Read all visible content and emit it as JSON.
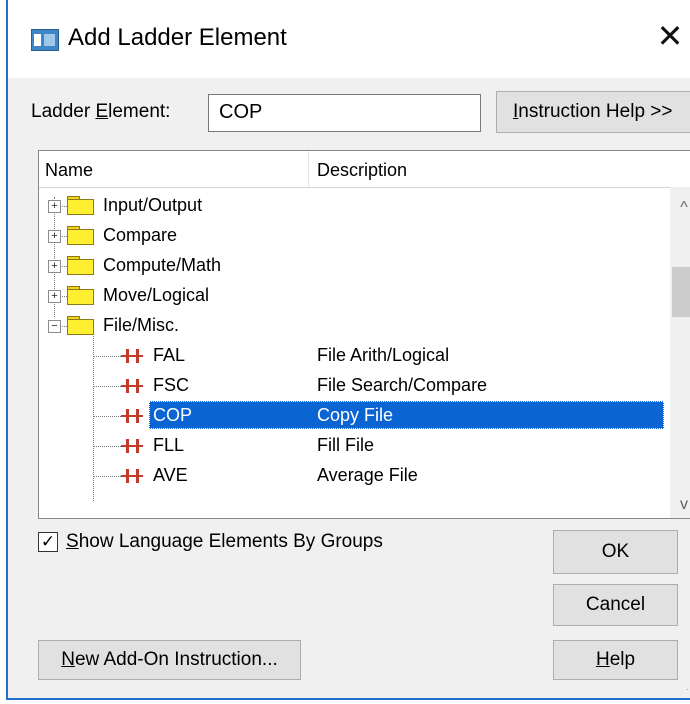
{
  "dialog": {
    "title": "Add Ladder Element",
    "close_glyph": "✕",
    "title_icon": "window-app-icon"
  },
  "element_field": {
    "label_pre": "Ladder ",
    "label_mnemonic": "E",
    "label_post": "lement:",
    "value": "COP"
  },
  "help_button": {
    "mnemonic": "I",
    "label_rest": "nstruction Help >>"
  },
  "list": {
    "columns": [
      "Name",
      "Description"
    ],
    "rows": [
      {
        "type": "group",
        "expander": "+",
        "name": "Input/Output",
        "description": ""
      },
      {
        "type": "group",
        "expander": "+",
        "name": "Compare",
        "description": ""
      },
      {
        "type": "group",
        "expander": "+",
        "name": "Compute/Math",
        "description": ""
      },
      {
        "type": "group",
        "expander": "+",
        "name": "Move/Logical",
        "description": ""
      },
      {
        "type": "group",
        "expander": "−",
        "name": "File/Misc.",
        "description": ""
      },
      {
        "type": "item",
        "name": "FAL",
        "description": "File Arith/Logical"
      },
      {
        "type": "item",
        "name": "FSC",
        "description": "File Search/Compare"
      },
      {
        "type": "item",
        "name": "COP",
        "description": "Copy File",
        "selected": true
      },
      {
        "type": "item",
        "name": "FLL",
        "description": "Fill File"
      },
      {
        "type": "item",
        "name": "AVE",
        "description": "Average File"
      }
    ],
    "scroll_up_glyph": "^",
    "scroll_down_glyph": "v"
  },
  "show_groups": {
    "checked": true,
    "check_glyph": "✓",
    "mnemonic": "S",
    "label_rest": "how Language Elements By Groups"
  },
  "buttons": {
    "ok": "OK",
    "cancel": "Cancel",
    "help_mnemonic": "H",
    "help_rest": "elp",
    "new_addon_mnemonic": "N",
    "new_addon_rest": "ew Add-On Instruction..."
  },
  "resize_grip": "⋰",
  "colors": {
    "selection": "#0a64d2",
    "rung": "#c23a2a",
    "folder": "#ffef32",
    "dialog_bg": "#f0f0f0",
    "border_accent": "#1e6fd0"
  }
}
